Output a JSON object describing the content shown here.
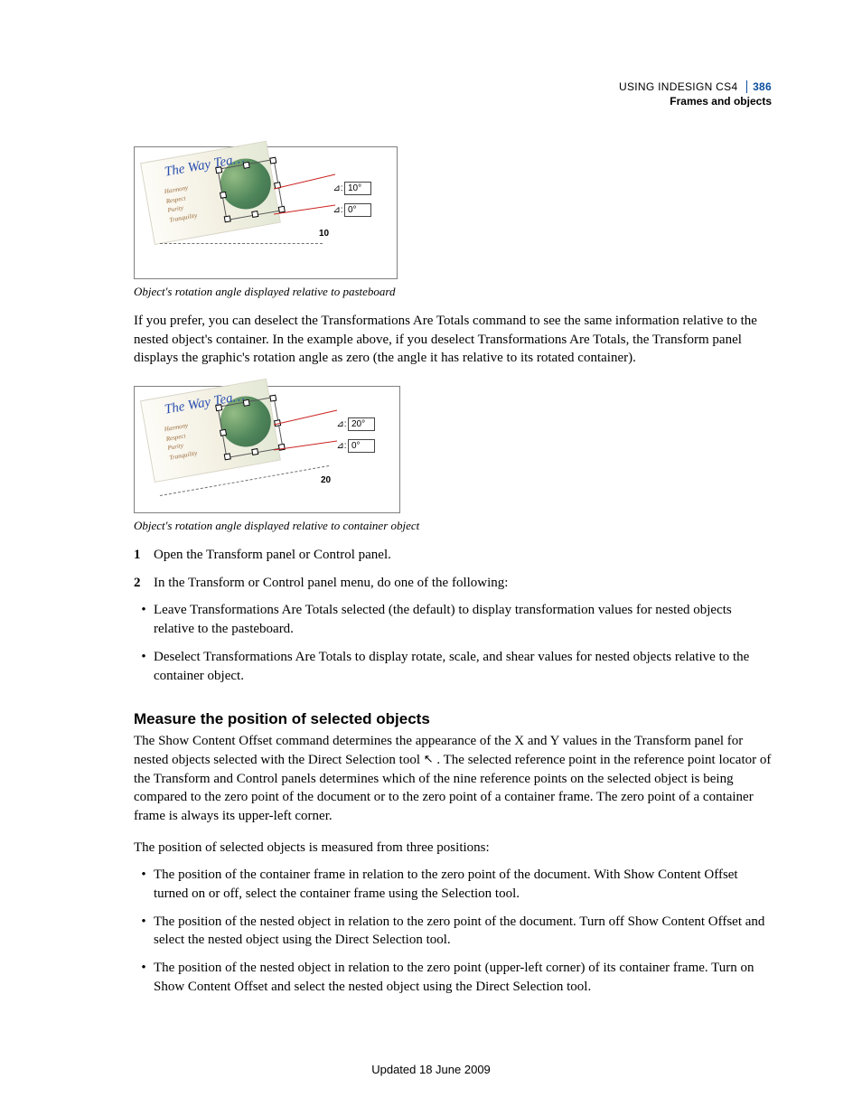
{
  "header": {
    "product": "USING INDESIGN CS4",
    "page": "386",
    "section": "Frames and objects"
  },
  "figure1": {
    "title": "The Way Tea…",
    "words": [
      "Harmony",
      "Respect",
      "Purity",
      "Tranquility"
    ],
    "label_a": "10°",
    "label_b": "0°",
    "angle_text": "10",
    "caption": "Object's rotation angle displayed relative to pasteboard"
  },
  "para1": "If you prefer, you can deselect the Transformations Are Totals command to see the same information relative to the nested object's container. In the example above, if you deselect Transformations Are Totals, the Transform panel displays the graphic's rotation angle as zero (the angle it has relative to its rotated container).",
  "figure2": {
    "title": "The Way Tea…",
    "words": [
      "Harmony",
      "Respect",
      "Purity",
      "Tranquility"
    ],
    "label_a": "20°",
    "label_b": "0°",
    "angle_text": "20",
    "caption": "Object's rotation angle displayed relative to container object"
  },
  "steps": [
    "Open the Transform panel or Control panel.",
    "In the Transform or Control panel menu, do one of the following:"
  ],
  "step_bullets": [
    "Leave Transformations Are Totals selected (the default) to display transformation values for nested objects relative to the pasteboard.",
    "Deselect Transformations Are Totals to display rotate, scale, and shear values for nested objects relative to the container object."
  ],
  "section2": {
    "heading": "Measure the position of selected objects",
    "para1a": "The Show Content Offset command determines the appearance of the X and Y values in the Transform panel for nested objects selected with the Direct Selection tool ",
    "para1b": " . The selected reference point in the reference point locator of the Transform and Control panels determines which of the nine reference points on the selected object is being compared to the zero point of the document or to the zero point of a container frame. The zero point of a container frame is always its upper-left corner.",
    "para2": "The position of selected objects is measured from three positions:",
    "bullets": [
      "The position of the container frame in relation to the zero point of the document. With Show Content Offset turned on or off, select the container frame using the Selection tool.",
      "The position of the nested object in relation to the zero point of the document. Turn off Show Content Offset and select the nested object using the Direct Selection tool.",
      "The position of the nested object in relation to the zero point (upper-left corner) of its container frame. Turn on Show Content Offset and select the nested object using the Direct Selection tool."
    ]
  },
  "footer": "Updated 18 June 2009"
}
